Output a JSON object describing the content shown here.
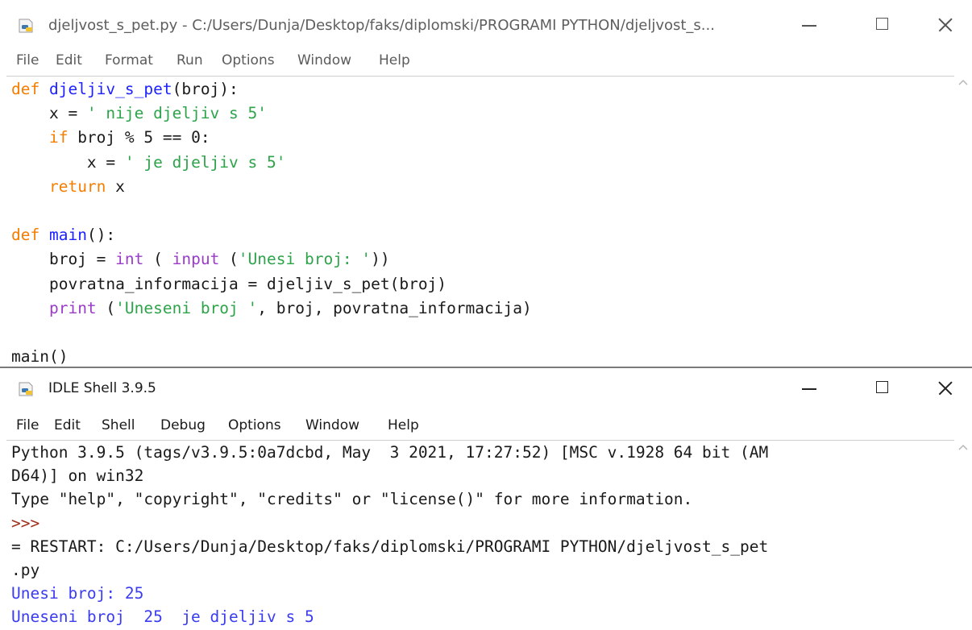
{
  "editor": {
    "title": "djeljvost_s_pet.py - C:/Users/Dunja/Desktop/faks/diplomski/PROGRAMI PYTHON/djeljvost_s...",
    "menu": [
      "File",
      "Edit",
      "Format",
      "Run",
      "Options",
      "Window",
      "Help"
    ],
    "code": [
      [
        {
          "t": "def",
          "c": "kw"
        },
        {
          "t": " "
        },
        {
          "t": "djeljiv_s_pet",
          "c": "fn"
        },
        {
          "t": "(broj):"
        }
      ],
      [
        {
          "t": "    x = "
        },
        {
          "t": "' nije djeljiv s 5'",
          "c": "str"
        }
      ],
      [
        {
          "t": "    "
        },
        {
          "t": "if",
          "c": "kw"
        },
        {
          "t": " broj % 5 == 0:"
        }
      ],
      [
        {
          "t": "        x = "
        },
        {
          "t": "' je djeljiv s 5'",
          "c": "str"
        }
      ],
      [
        {
          "t": "    "
        },
        {
          "t": "return",
          "c": "kw"
        },
        {
          "t": " x"
        }
      ],
      [],
      [
        {
          "t": "def",
          "c": "kw"
        },
        {
          "t": " "
        },
        {
          "t": "main",
          "c": "fn"
        },
        {
          "t": "():"
        }
      ],
      [
        {
          "t": "    broj = "
        },
        {
          "t": "int",
          "c": "bi"
        },
        {
          "t": " ( "
        },
        {
          "t": "input",
          "c": "bi"
        },
        {
          "t": " ("
        },
        {
          "t": "'Unesi broj: '",
          "c": "str"
        },
        {
          "t": "))"
        }
      ],
      [
        {
          "t": "    povratna_informacija = djeljiv_s_pet(broj)"
        }
      ],
      [
        {
          "t": "    "
        },
        {
          "t": "print",
          "c": "bi"
        },
        {
          "t": " ("
        },
        {
          "t": "'Uneseni broj '",
          "c": "str"
        },
        {
          "t": ", broj, povratna_informacija)"
        }
      ],
      [],
      [
        {
          "t": "main()"
        }
      ]
    ]
  },
  "shell": {
    "title": "IDLE Shell 3.9.5",
    "menu": [
      "File",
      "Edit",
      "Shell",
      "Debug",
      "Options",
      "Window",
      "Help"
    ],
    "lines": [
      [
        {
          "t": "Python 3.9.5 (tags/v3.9.5:0a7dcbd, May  3 2021, 17:27:52) [MSC v.1928 64 bit (AM"
        }
      ],
      [
        {
          "t": "D64)] on win32"
        }
      ],
      [
        {
          "t": "Type \"help\", \"copyright\", \"credits\" or \"license()\" for more information."
        }
      ],
      [
        {
          "t": ">>>",
          "c": "prompt"
        }
      ],
      [
        {
          "t": "= RESTART: C:/Users/Dunja/Desktop/faks/diplomski/PROGRAMI PYTHON/djeljvost_s_pet"
        }
      ],
      [
        {
          "t": ".py"
        }
      ],
      [
        {
          "t": "Unesi broj: 25",
          "c": "out"
        }
      ],
      [
        {
          "t": "Uneseni broj  25  je djeljiv s 5",
          "c": "out"
        }
      ]
    ]
  },
  "colors": {
    "keyword": "#f57d00",
    "function_name": "#1e22ff",
    "string": "#2da34a",
    "builtin": "#9b3cc9",
    "prompt": "#a0311d",
    "stdout": "#3a3cf0"
  },
  "icons": [
    "python-file-icon",
    "minimize-icon",
    "maximize-icon",
    "close-icon",
    "scroll-up-arrow-icon"
  ]
}
